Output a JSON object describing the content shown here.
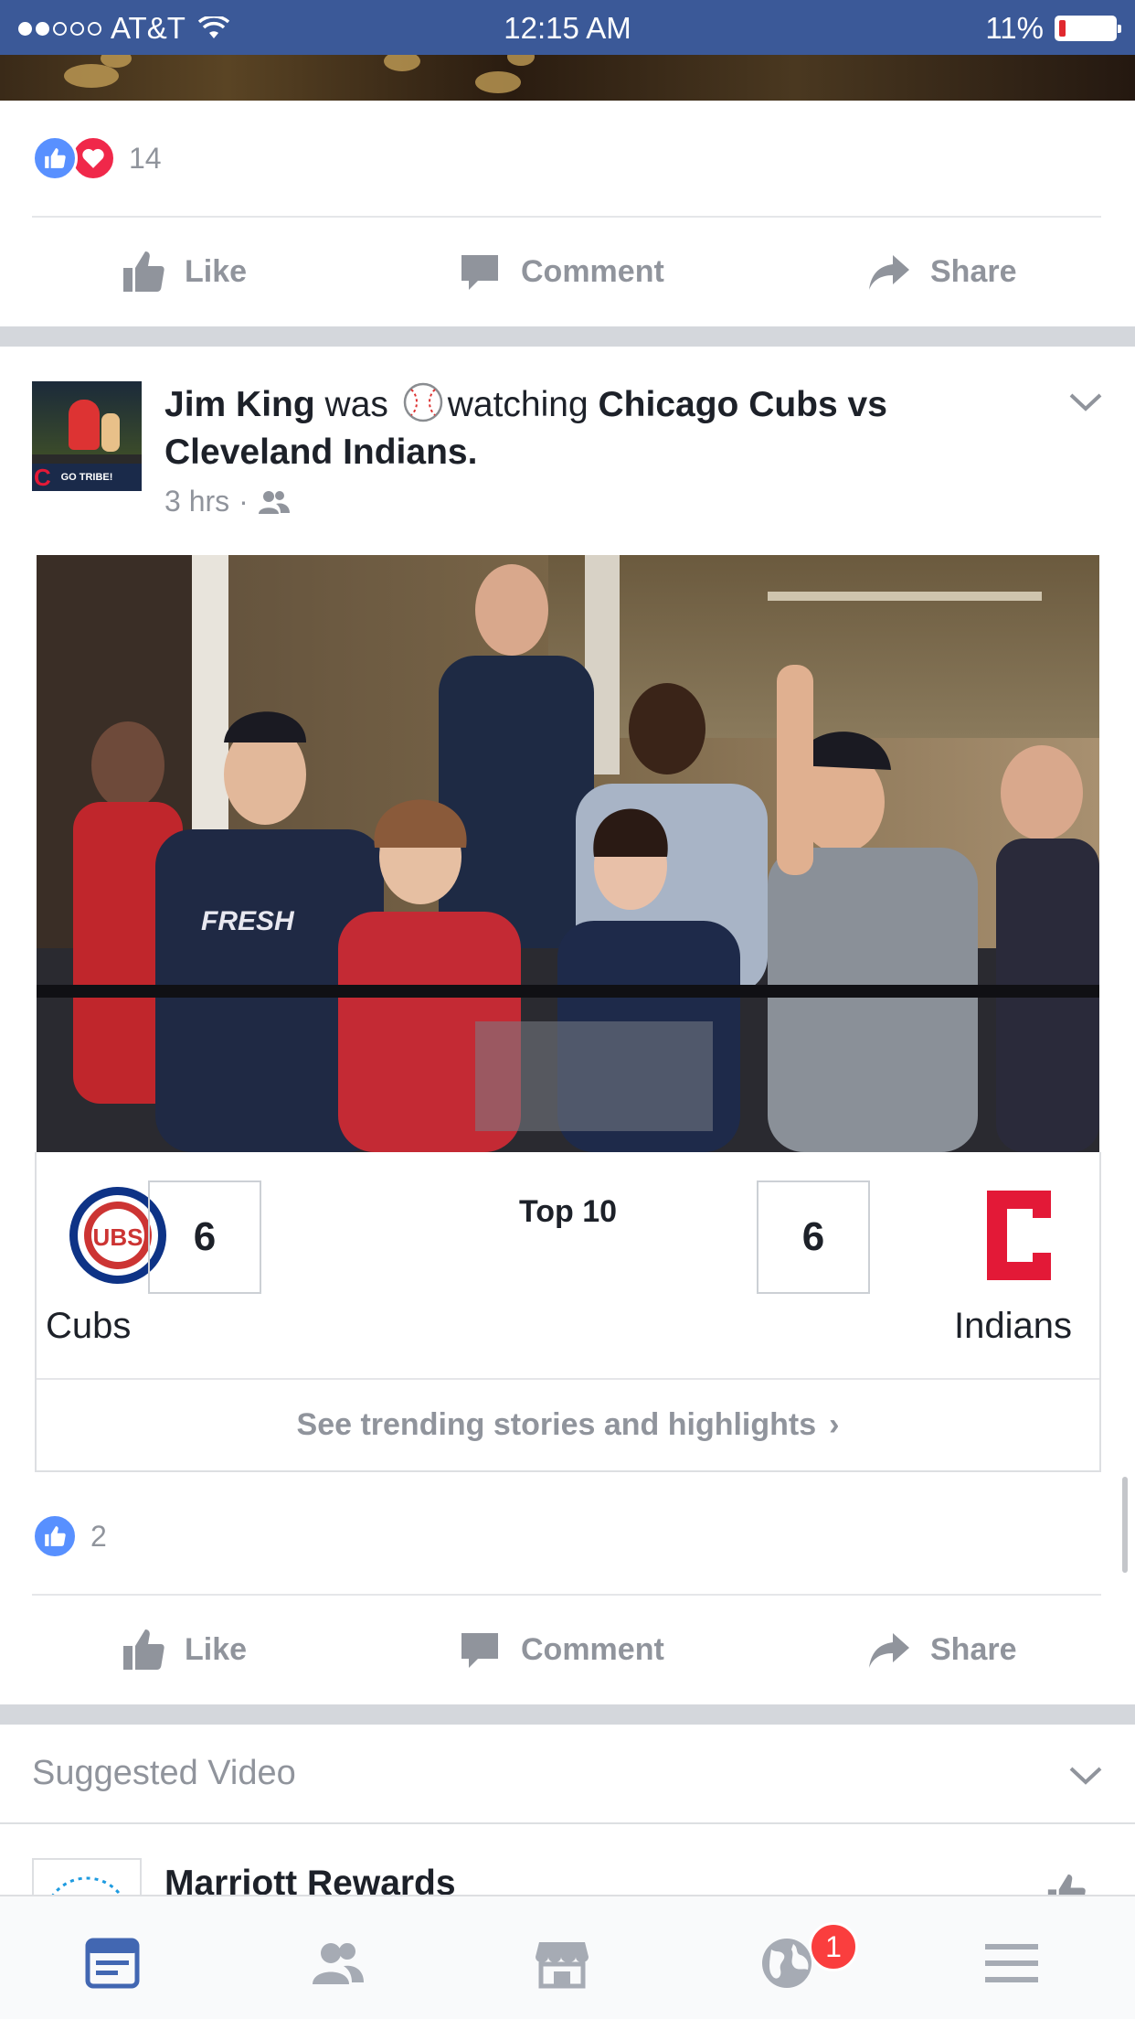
{
  "status_bar": {
    "carrier": "AT&T",
    "time": "12:15 AM",
    "battery_percent": "11%",
    "battery_level": 0.11
  },
  "previous_post": {
    "reaction_count": "14",
    "actions": {
      "like": "Like",
      "comment": "Comment",
      "share": "Share"
    }
  },
  "post": {
    "author": "Jim King",
    "verb_was": "was",
    "activity": "watching",
    "subject_line1": "Chicago Cubs vs",
    "subject_line2": "Cleveland Indians.",
    "timestamp": "3 hrs",
    "separator": "·",
    "avatar_banner": "GO TRIBE!",
    "scoreboard": {
      "inning": "Top 10",
      "away_team": "Cubs",
      "away_score": "6",
      "home_team": "Indians",
      "home_score": "6",
      "away_logo_text": "UBS"
    },
    "trending_link": "See trending stories and highlights",
    "trending_chevron": "›",
    "reaction_count": "2",
    "actions": {
      "like": "Like",
      "comment": "Comment",
      "share": "Share"
    }
  },
  "suggested": {
    "title": "Suggested Video",
    "sponsor_name": "Marriott Rewards"
  },
  "tab_bar": {
    "notifications_badge": "1"
  },
  "colors": {
    "brand_blue": "#3b5998",
    "like_blue": "#5890ff",
    "love_red": "#f0284a",
    "text_gray": "#90949c",
    "badge_red": "#fa3e3e"
  }
}
